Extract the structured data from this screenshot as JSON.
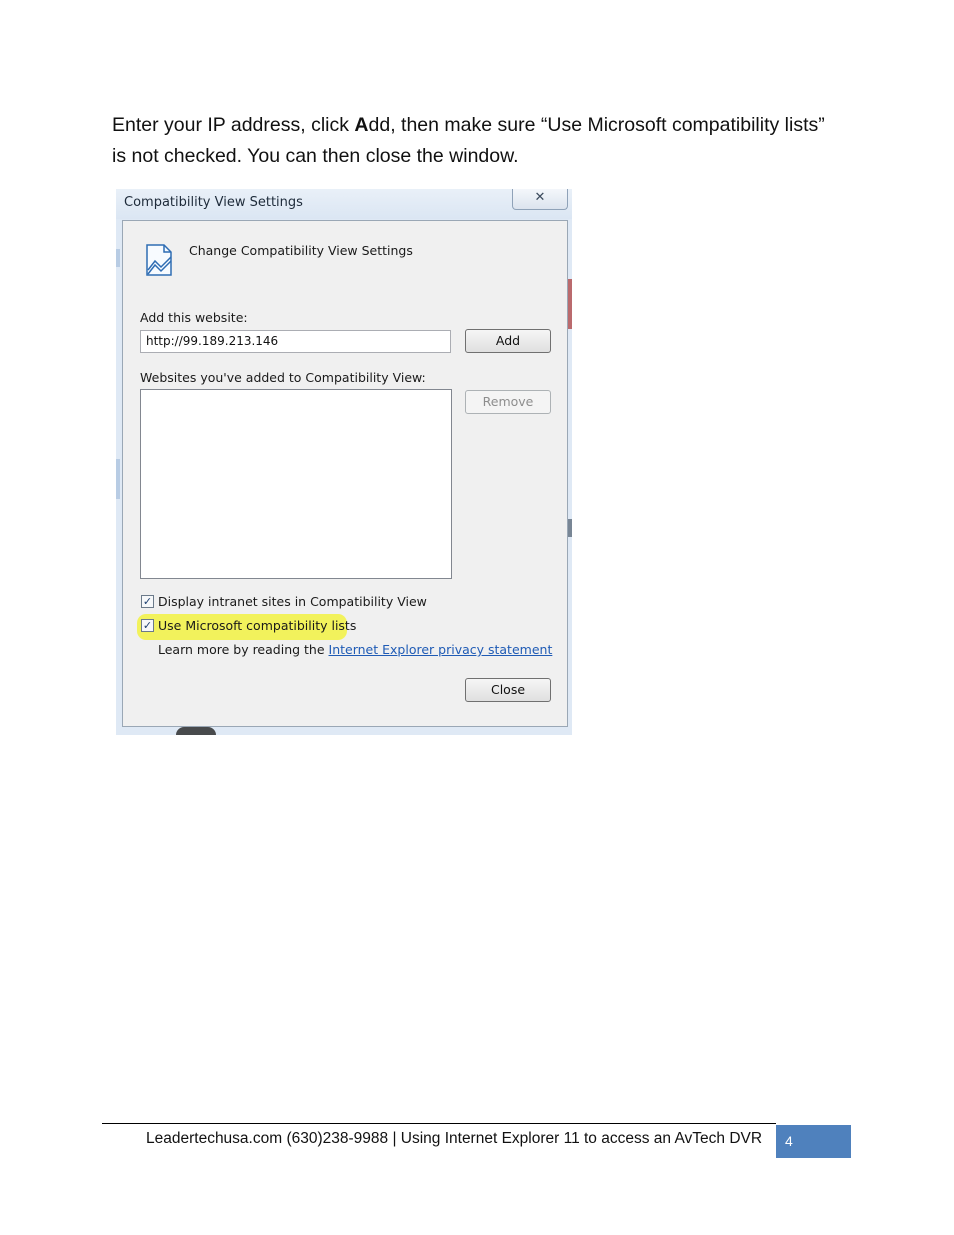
{
  "instructions": {
    "part1": "Enter your IP address, click ",
    "bold_letter": "A",
    "part2": "dd, then make sure “Use Microsoft compatibility lists” is not checked. You can then close the window."
  },
  "dialog": {
    "title": "Compatibility View Settings",
    "close_glyph": "✕",
    "heading": "Change Compatibility View Settings",
    "add_label": "Add this website:",
    "url_value": "http://99.189.213.146",
    "add_button": "Add",
    "list_label": "Websites you've added to Compatibility View:",
    "remove_button": "Remove",
    "checkbox1_label": "Display intranet sites in Compatibility View",
    "checkbox2_label": "Use Microsoft compatibility lists",
    "learn_more": "Learn more by reading the ",
    "privacy_link": "Internet Explorer privacy statement",
    "close_button": "Close",
    "highlight_color": "#f2f25c"
  },
  "footer": {
    "text": "Leadertechusa.com  (630)238-9988 | Using Internet Explorer 11 to access an AvTech DVR",
    "page_number": "4",
    "accent_color": "#4f81bd"
  }
}
